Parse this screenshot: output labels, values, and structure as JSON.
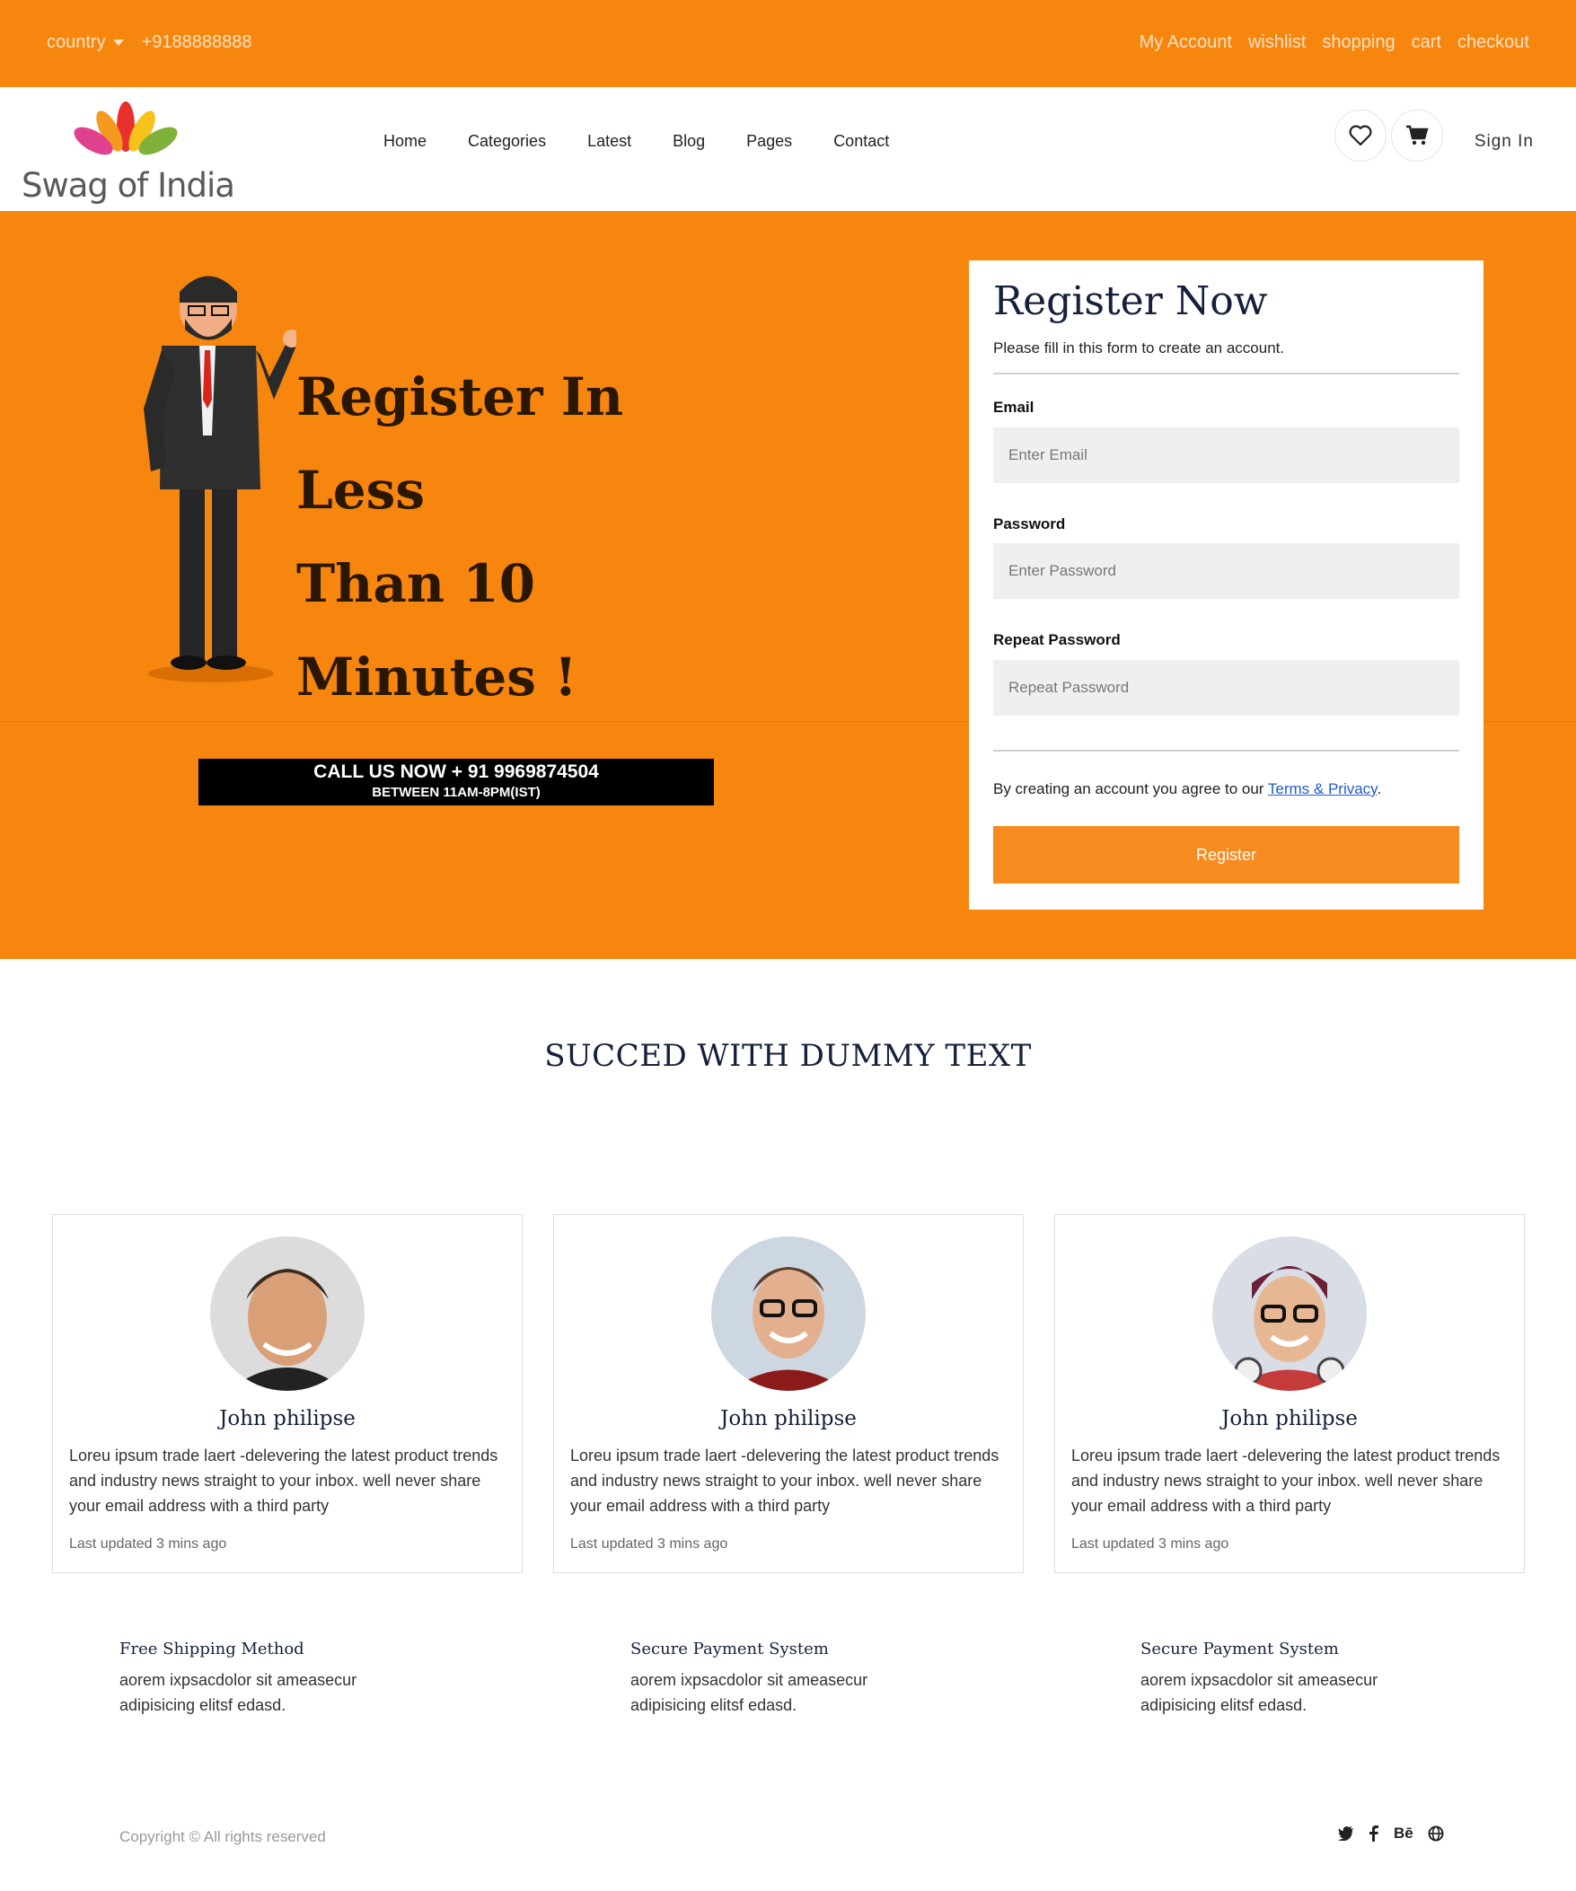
{
  "topbar": {
    "country": "country",
    "phone": "+9188888888",
    "links": [
      "My Account",
      "wishlist",
      "shopping",
      "cart",
      "checkout"
    ]
  },
  "nav": {
    "logo_text": "Swag of India",
    "menu": [
      "Home",
      "Categories",
      "Latest",
      "Blog",
      "Pages",
      "Contact"
    ],
    "sign_in": "Sign In"
  },
  "hero": {
    "title_line1": "Register In Less",
    "title_line2": "Than 10 Minutes !",
    "call_line1": "CALL US NOW + 91 9969874504",
    "call_line2": "BETWEEN 11AM-8PM(IST)"
  },
  "form": {
    "title": "Register Now",
    "subtitle": "Please fill in this form to create an account.",
    "email_label": "Email",
    "email_placeholder": "Enter Email",
    "password_label": "Password",
    "password_placeholder": "Enter Password",
    "repeat_label": "Repeat Password",
    "repeat_placeholder": "Repeat Password",
    "terms_text": "By creating an account you agree to our ",
    "terms_link": "Terms & Privacy",
    "terms_end": ".",
    "button": "Register"
  },
  "section": {
    "title": "SUCCED WITH DUMMY TEXT"
  },
  "cards": [
    {
      "name": "John philipse",
      "desc": "Loreu ipsum trade laert -delevering the latest product trends and industry news straight to your inbox. well never share your email address with a third party",
      "updated": "Last updated 3 mins ago"
    },
    {
      "name": "John philipse",
      "desc": "Loreu ipsum trade laert -delevering the latest product trends and industry news straight to your inbox. well never share your email address with a third party",
      "updated": "Last updated 3 mins ago"
    },
    {
      "name": "John philipse",
      "desc": "Loreu ipsum trade laert -delevering the latest product trends and industry news straight to your inbox. well never share your email address with a third party",
      "updated": "Last updated 3 mins ago"
    }
  ],
  "features": [
    {
      "title": "Free Shipping Method",
      "desc": "aorem ixpsacdolor sit ameasecur adipisicing elitsf edasd."
    },
    {
      "title": "Secure Payment System",
      "desc": "aorem ixpsacdolor sit ameasecur adipisicing elitsf edasd."
    },
    {
      "title": "Secure Payment System",
      "desc": "aorem ixpsacdolor sit ameasecur adipisicing elitsf edasd."
    }
  ],
  "footer": {
    "copyright": "Copyright © All rights reserved",
    "social": [
      "twitter-icon",
      "facebook-icon",
      "behance-icon",
      "globe-icon"
    ],
    "behance_text": "Bē"
  },
  "colors": {
    "brand_orange": "#f7860f",
    "button_orange": "#f68b1f",
    "heading_navy": "#15203a"
  }
}
